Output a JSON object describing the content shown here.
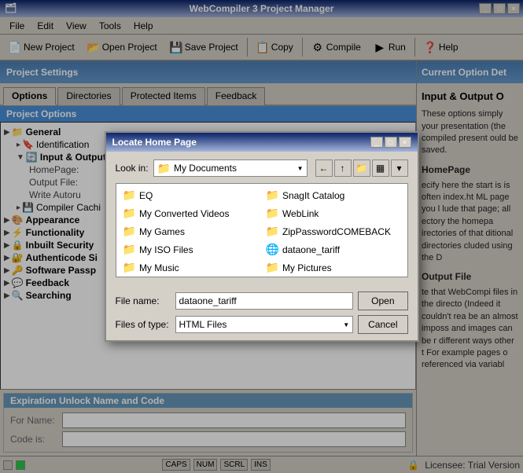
{
  "titleBar": {
    "title": "WebCompiler 3 Project Manager",
    "icon": "🗂"
  },
  "menuBar": {
    "items": [
      "File",
      "Edit",
      "View",
      "Tools",
      "Help"
    ]
  },
  "toolbar": {
    "buttons": [
      {
        "label": "New Project",
        "icon": "📄"
      },
      {
        "label": "Open Project",
        "icon": "📂"
      },
      {
        "label": "Save Project",
        "icon": "💾"
      },
      {
        "label": "Copy",
        "icon": "📋"
      },
      {
        "label": "Compile",
        "icon": "⚙"
      },
      {
        "label": "Run",
        "icon": "▶"
      },
      {
        "label": "Help",
        "icon": "❓"
      }
    ]
  },
  "leftPanel": {
    "header": "Project Settings",
    "tabs": [
      "Options",
      "Directories",
      "Protected Items",
      "Feedback"
    ],
    "activeTab": "Options",
    "projectOptionsLabel": "Project Options",
    "tree": {
      "nodes": [
        {
          "indent": 0,
          "expand": "▶",
          "icon": "📁",
          "label": "General",
          "bold": true
        },
        {
          "indent": 1,
          "expand": "▸",
          "icon": "🔖",
          "label": "Identification"
        },
        {
          "indent": 1,
          "expand": "▼",
          "icon": "🔄",
          "label": "Input & Output"
        },
        {
          "indent": 2,
          "expand": "",
          "icon": "",
          "label": "HomePage:"
        },
        {
          "indent": 2,
          "expand": "",
          "icon": "",
          "label": "Output File:"
        },
        {
          "indent": 2,
          "expand": "",
          "icon": "",
          "label": "Write Autoru"
        },
        {
          "indent": 1,
          "expand": "▸",
          "icon": "💾",
          "label": "Compiler Cachi"
        },
        {
          "indent": 0,
          "expand": "▶",
          "icon": "🎨",
          "label": "Appearance"
        },
        {
          "indent": 0,
          "expand": "▶",
          "icon": "⚡",
          "label": "Functionality"
        },
        {
          "indent": 0,
          "expand": "▶",
          "icon": "🔒",
          "label": "Inbuilt Security"
        },
        {
          "indent": 0,
          "expand": "▶",
          "icon": "🔐",
          "label": "Authenticode Si"
        },
        {
          "indent": 0,
          "expand": "▶",
          "icon": "🔑",
          "label": "Software Passp"
        },
        {
          "indent": 0,
          "expand": "▶",
          "icon": "💬",
          "label": "Feedback"
        },
        {
          "indent": 0,
          "expand": "▶",
          "icon": "🔍",
          "label": "Searching"
        }
      ]
    }
  },
  "expiration": {
    "header": "Expiration Unlock Name and Code",
    "fields": [
      {
        "label": "For Name:",
        "value": ""
      },
      {
        "label": "Code is:",
        "value": ""
      }
    ]
  },
  "rightPanel": {
    "header": "Current Option Det",
    "sectionTitle": "Input & Output O",
    "body1": "These options simply your presentation (the compiled present ould be saved.",
    "homepageTitle": "HomePage",
    "homepageBody": "ecify here the start is is often index.ht ML page you l lude that page; all ectory the homepa irectories of that ditional directories cluded using the D",
    "outputTitle": "Output File",
    "outputBody": "te that WebCompi files in the directo (Indeed it couldn't rea be an almost imposs and images can be r different ways other t For example pages o referenced via variabl"
  },
  "modal": {
    "title": "Locate Home Page",
    "lookInLabel": "Look in:",
    "lookInValue": "My Documents",
    "files": [
      {
        "name": "EQ",
        "type": "folder"
      },
      {
        "name": "SnagIt Catalog",
        "type": "folder"
      },
      {
        "name": "My Converted Videos",
        "type": "folder"
      },
      {
        "name": "WebLink",
        "type": "folder"
      },
      {
        "name": "My Games",
        "type": "folder"
      },
      {
        "name": "ZipPasswordCOMEBACK",
        "type": "folder"
      },
      {
        "name": "My ISO Files",
        "type": "folder"
      },
      {
        "name": "dataone_tariff",
        "type": "file"
      },
      {
        "name": "My Music",
        "type": "folder"
      },
      {
        "name": "My Pictures",
        "type": "folder"
      }
    ],
    "filenameLabel": "File name:",
    "filenameValue": "dataone_tariff",
    "filetypeLabel": "Files of type:",
    "filetypeValue": "HTML Files",
    "openButton": "Open",
    "cancelButton": "Cancel"
  },
  "statusBar": {
    "indicators": [
      "CAPS",
      "NUM",
      "SCRL",
      "INS"
    ],
    "licenseText": "Licensee: Trial Version"
  }
}
